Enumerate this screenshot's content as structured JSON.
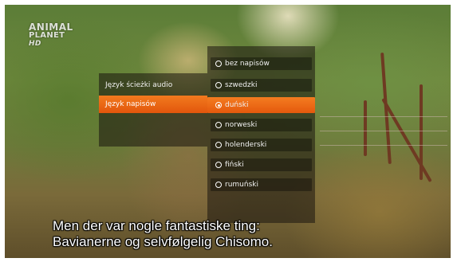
{
  "channel_logo": {
    "line1": "ANIMAL",
    "line2": "PLANET",
    "line3": "HD"
  },
  "settings_menu": {
    "items": [
      {
        "label": "Język ścieżki audio",
        "active": false
      },
      {
        "label": "Język napisów",
        "active": true
      }
    ]
  },
  "subtitle_options": {
    "items": [
      {
        "label": "bez napisów",
        "selected": false
      },
      {
        "label": "szwedzki",
        "selected": false
      },
      {
        "label": "duński",
        "selected": true
      },
      {
        "label": "norweski",
        "selected": false
      },
      {
        "label": "holenderski",
        "selected": false
      },
      {
        "label": "fiński",
        "selected": false
      },
      {
        "label": "rumuński",
        "selected": false
      }
    ]
  },
  "subtitle_text": {
    "line1": "Men der var nogle fantastiske ting:",
    "line2": "Bavianerne og selvfølgelig Chisomo."
  },
  "colors": {
    "accent": "#f27a1e",
    "menu_background": "rgba(25,20,15,0.55)",
    "text": "#ffffff"
  }
}
